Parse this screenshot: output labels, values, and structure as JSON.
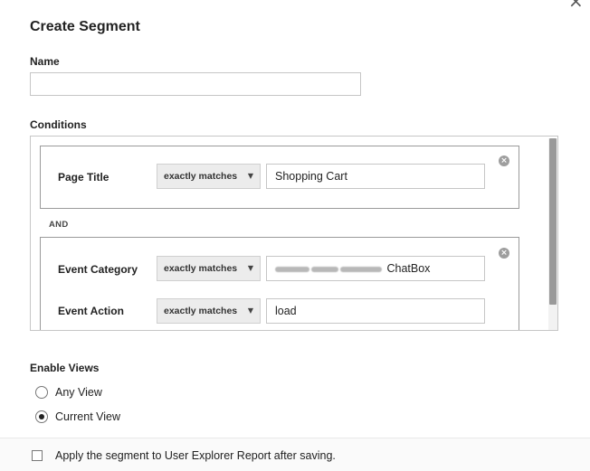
{
  "dialog": {
    "title": "Create Segment",
    "close_glyph": "×"
  },
  "name_section": {
    "label": "Name",
    "value": "",
    "placeholder": ""
  },
  "conditions": {
    "label": "Conditions",
    "and_label": "AND",
    "groups": [
      {
        "rows": [
          {
            "dimension": "Page Title",
            "operator": "exactly matches",
            "value": "Shopping Cart"
          }
        ]
      },
      {
        "rows": [
          {
            "dimension": "Event Category",
            "operator": "exactly matches",
            "value": "ChatBox",
            "value_redacted_prefix": true
          },
          {
            "dimension": "Event Action",
            "operator": "exactly matches",
            "value": "load"
          }
        ]
      }
    ],
    "caret_glyph": "▼",
    "remove_glyph": "×"
  },
  "enable_views": {
    "label": "Enable Views",
    "options": [
      {
        "label": "Any View",
        "selected": false
      },
      {
        "label": "Current View",
        "selected": true
      }
    ]
  },
  "footer": {
    "checkbox_label": "Apply the segment to User Explorer Report after saving.",
    "checked": false
  }
}
